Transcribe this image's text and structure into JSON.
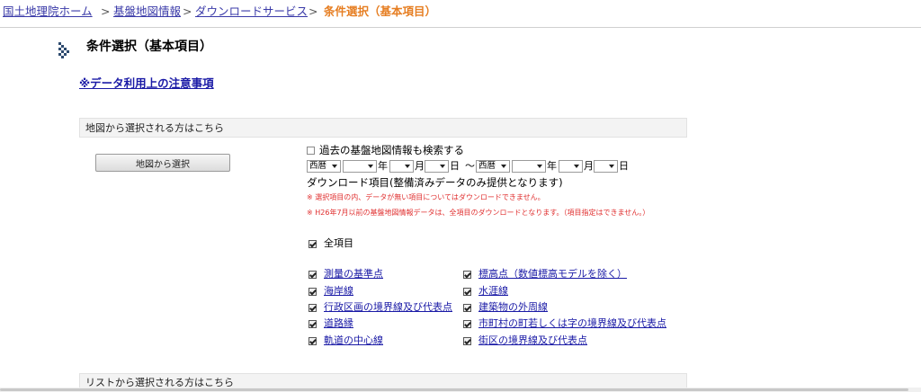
{
  "breadcrumb": {
    "home": "国土地理院ホーム",
    "sep": ">",
    "kiban": "基盤地図情報",
    "download": "ダウンロードサービス",
    "current": "条件選択（基本項目）"
  },
  "page": {
    "title": "条件選択（基本項目）",
    "notice_link": "※データ利用上の注意事項"
  },
  "map_section": {
    "header": "地図から選択される方はこちら",
    "button": "地図から選択"
  },
  "list_section": {
    "header": "リストから選択される方はこちら"
  },
  "past_search": {
    "label": "過去の基盤地図情報も検索する",
    "checked": false
  },
  "date_range": {
    "from": {
      "era": "西暦",
      "year": "",
      "month": "",
      "day": ""
    },
    "to": {
      "era": "西暦",
      "year": "",
      "month": "",
      "day": ""
    },
    "year_unit": "年",
    "month_unit": "月",
    "day_unit": "日",
    "tilde": "〜"
  },
  "download_items": {
    "label": "ダウンロード項目(整備済みデータのみ提供となります)",
    "warning1": "※ 選択項目の内、データが無い項目についてはダウンロードできません。",
    "warning2": "※ H26年7月以前の基盤地図情報データは、全項目のダウンロードとなります。（項目指定はできません。）",
    "all_label": "全項目",
    "all_checked": true,
    "left": [
      {
        "label": "測量の基準点",
        "checked": true
      },
      {
        "label": "海岸線",
        "checked": true
      },
      {
        "label": "行政区画の境界線及び代表点",
        "checked": true
      },
      {
        "label": "道路縁",
        "checked": true
      },
      {
        "label": "軌道の中心線",
        "checked": true
      }
    ],
    "right": [
      {
        "label": "標高点（数値標高モデルを除く）",
        "checked": true
      },
      {
        "label": "水涯線",
        "checked": true
      },
      {
        "label": "建築物の外周線",
        "checked": true
      },
      {
        "label": "市町村の町若しくは字の境界線及び代表点",
        "checked": true
      },
      {
        "label": "街区の境界線及び代表点",
        "checked": true
      }
    ]
  },
  "icons": {
    "title_marker": "double-chevron-icon",
    "select_arrow": "triangle-down-icon",
    "checkbox": "checkbox-icon"
  },
  "colors": {
    "link": "#1a1aa6",
    "breadcrumb_current": "#e67e22",
    "warning": "#e03030",
    "section_header_bg": "#f3f3f3"
  }
}
